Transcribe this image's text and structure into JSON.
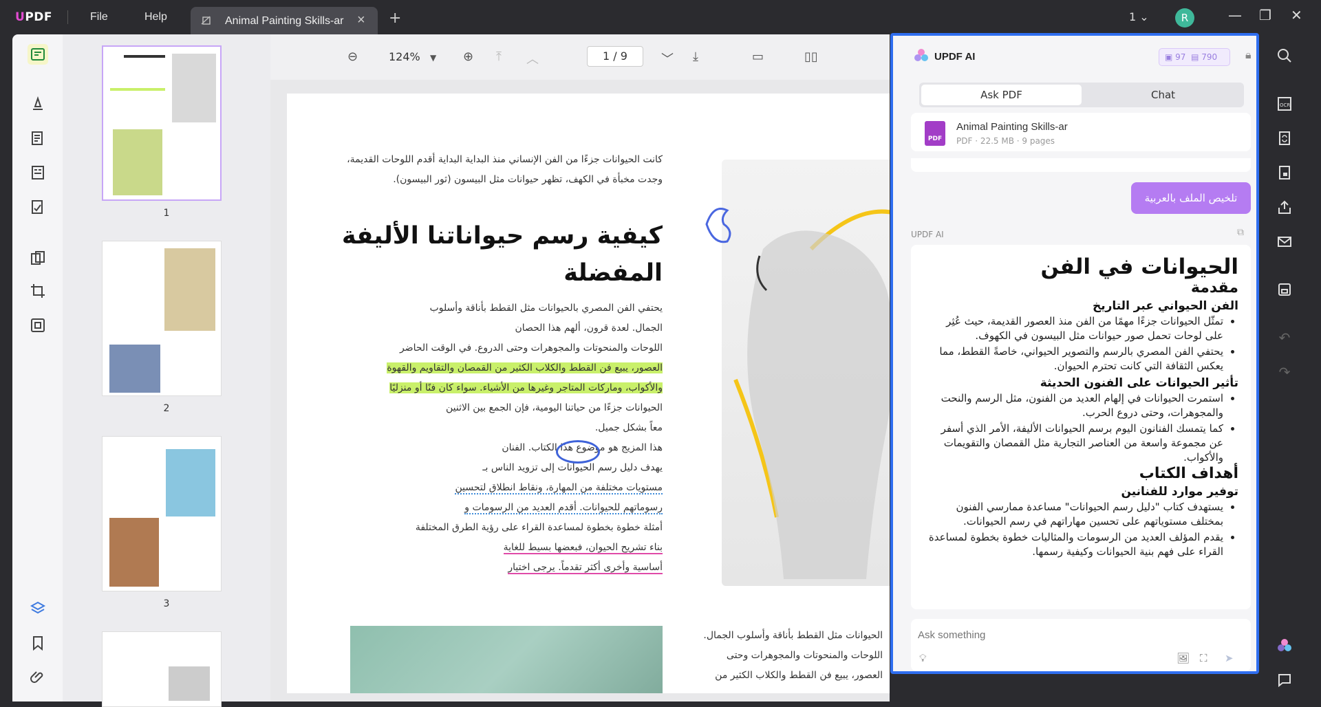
{
  "app": {
    "logo_prefix": "U",
    "logo_rest": "PDF"
  },
  "menu": {
    "file": "File",
    "help": "Help"
  },
  "tab": {
    "title": "Animal Painting Skills-ar",
    "close": "×"
  },
  "titlebar": {
    "page_selector": "1 ⌄",
    "avatar": "R",
    "add_tab": "+"
  },
  "thumbnails": [
    {
      "num": "1"
    },
    {
      "num": "2"
    },
    {
      "num": "3"
    }
  ],
  "toolbar": {
    "zoom": "124%",
    "page_current": "1",
    "page_total": "9",
    "page_sep": "/"
  },
  "document": {
    "intro": [
      "كانت الحيوانات جزءًا من الفن الإنساني منذ البداية البداية أقدم اللوحات القديمة،",
      "وجدت مخبأة في الكهف، تظهر حيوانات مثل البيسون (ثور البيسون)."
    ],
    "heading_1": "كيفية رسم حيواناتنا الأليفة",
    "heading_2": "المفضلة",
    "body": [
      "يحتفي الفن المصري بالحيوانات مثل القطط بأناقة وأسلوب",
      "الجمال. لعدة قرون، ألهم هذا الحصان",
      "اللوحات والمنحوتات والمجوهرات وحتى الدروع. في الوقت الحاضر",
      "العصور، يبيع فن القطط والكلاب الكثير من القمصان والتقاويم والقهوة",
      "والأكواب، وماركات المتاجر وغيرها من الأشياء. سواء كان فنًا أو منزليًا",
      "الحيوانات جزءًا من حياتنا اليومية، فإن الجمع بين الاثنين",
      "معاً بشكل جميل.",
      "هذا المزيج هو موضوع هذا الكتاب. الفنان",
      "يهدف دليل رسم الحيوانات إلى تزويد الناس بـ",
      "مستويات مختلفة من المهارة، ونقاط انطلاق لتحسين",
      "رسوماتهم للحيوانات. أقدم العديد من الرسومات و",
      "أمثلة خطوة بخطوة لمساعدة القراء على رؤية الطرق المختلفة",
      "بناء تشريح الحيوان، فبعضها بسيط للغاية",
      "أساسية وأخرى أكثر تقدماً. يرجى اختيار"
    ],
    "right_col": [
      "الحيوانات مثل القطط بأناقة وأسلوب الجمال.",
      "اللوحات والمنحوتات والمجوهرات وحتى",
      "العصور، يبيع فن القطط والكلاب الكثير من"
    ]
  },
  "ai": {
    "title": "UPDF AI",
    "credits_a": "97",
    "credits_b": "790",
    "tab_ask": "Ask PDF",
    "tab_chat": "Chat",
    "file_name": "Animal Painting Skills-ar",
    "file_meta": "PDF · 22.5 MB · 9 pages",
    "pdf_badge": "PDF",
    "prompt": "تلخيص الملف بالعربية",
    "label": "UPDF AI",
    "answer": {
      "h1": "الحيوانات في الفن",
      "h2a": "مقدمة",
      "h3a": "الفن الحيواني عبر التاريخ",
      "li1": "تمثّل الحيوانات جزءًا مهمًا من الفن منذ العصور القديمة، حيث عُثِر على لوحات تحمل صور حيوانات مثل البيسون في الكهوف.",
      "li2": "يحتفي الفن المصري بالرسم والتصوير الحيواني، خاصةً القطط، مما يعكس الثقافة التي كانت تحترم الحيوان.",
      "h3b": "تأثير الحيوانات على الفنون الحديثة",
      "li3": "استمرت الحيوانات في إلهام العديد من الفنون، مثل الرسم والنحت والمجوهرات، وحتى دروع الحرب.",
      "li4": "كما يتمسك الفنانون اليوم برسم الحيوانات الأليفة، الأمر الذي أسفر عن مجموعة واسعة من العناصر التجارية مثل القمصان والتقويمات والأكواب.",
      "h2b": "أهداف الكتاب",
      "h3c": "توفير موارد للفنانين",
      "li5": "يستهدف كتاب \"دليل رسم الحيوانات\" مساعدة ممارسي الفنون بمختلف مستوياتهم على تحسين مهاراتهم في رسم الحيوانات.",
      "li6": "يقدم المؤلف العديد من الرسومات والمثاليات خطوة بخطوة لمساعدة القراء على فهم بنية الحيوانات وكيفية رسمها."
    },
    "ask_placeholder": "Ask something"
  },
  "colors": {
    "accent": "#2f6ef0",
    "prompt_bubble": "#b57cf2",
    "highlight": "#c9f06a"
  }
}
